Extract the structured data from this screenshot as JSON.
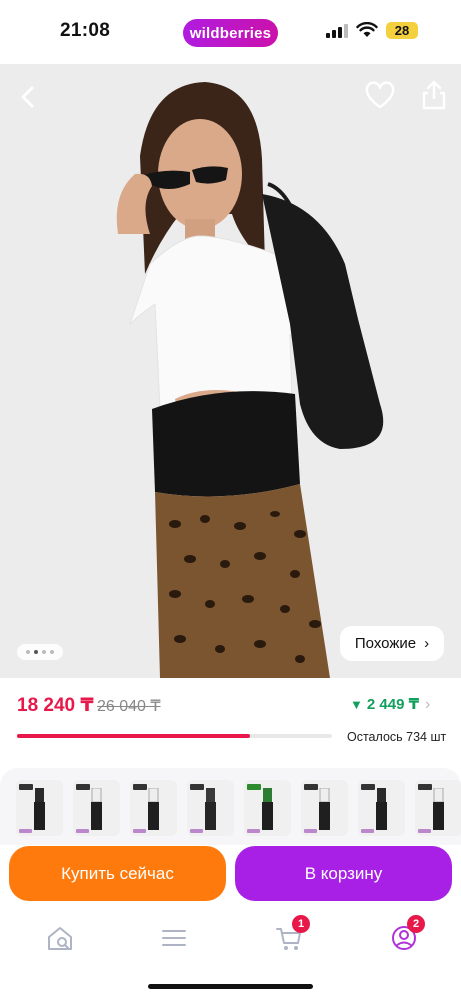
{
  "status_bar": {
    "time": "21:08",
    "brand": "wildberries",
    "battery": "28"
  },
  "hero": {
    "icons": [
      "chevron-left-icon",
      "heart-icon",
      "share-icon"
    ],
    "similar_label": "Похожие",
    "similar_arrow": "›",
    "carousel_count": 4,
    "carousel_active": 1
  },
  "price": {
    "current": "18 240 ₸",
    "old": "26 040 ₸",
    "wallet": "2 449 ₸",
    "wallet_arrow": "▼",
    "chevron": "›",
    "stock_text": "Осталось 734 шт",
    "stock_fraction": 0.74
  },
  "colors": {
    "accent_pink": "#e8184a",
    "buy_orange": "#ff7a0c",
    "cart_purple": "#a820e6",
    "wallet_green": "#12a05c"
  },
  "buttons": {
    "buy_now": "Купить сейчас",
    "add_to_cart": "В корзину"
  },
  "bottom_nav": {
    "items": [
      {
        "name": "home-search-icon"
      },
      {
        "name": "catalog-menu-icon"
      },
      {
        "name": "cart-icon",
        "badge": "1"
      },
      {
        "name": "profile-icon",
        "badge": "2"
      }
    ]
  }
}
